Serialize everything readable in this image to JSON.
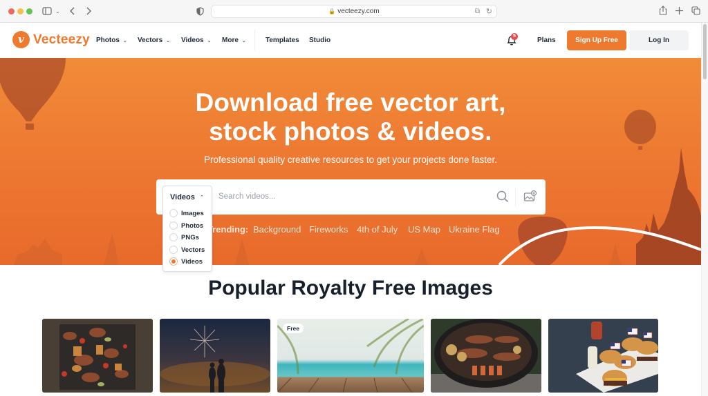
{
  "browser": {
    "url": "vecteezy.com",
    "icons": [
      "sidebar-icon",
      "chevron-down-icon",
      "back-icon",
      "forward-icon",
      "shield-icon",
      "lock-icon",
      "translate-icon",
      "reload-icon",
      "share-icon",
      "new-tab-icon",
      "tabs-overview-icon"
    ]
  },
  "nav": {
    "brand": "Vecteezy",
    "logo_glyph": "v",
    "menu": [
      {
        "label": "Photos",
        "has_dropdown": true
      },
      {
        "label": "Vectors",
        "has_dropdown": true
      },
      {
        "label": "Videos",
        "has_dropdown": true
      },
      {
        "label": "More",
        "has_dropdown": true
      },
      {
        "label": "Templates",
        "has_dropdown": false
      },
      {
        "label": "Studio",
        "has_dropdown": false
      }
    ],
    "notification_count": "5",
    "plans": "Plans",
    "signup": "Sign Up Free",
    "login": "Log In",
    "chev": "⌄"
  },
  "hero": {
    "title_line1": "Download free vector art,",
    "title_line2": "stock photos & videos.",
    "subtitle": "Professional quality creative resources to get your projects done faster.",
    "search": {
      "type_selected": "Videos",
      "placeholder": "Search videos...",
      "value": ""
    },
    "dropdown": {
      "options": [
        {
          "label": "Images",
          "selected": false
        },
        {
          "label": "Photos",
          "selected": false
        },
        {
          "label": "PNGs",
          "selected": false
        },
        {
          "label": "Vectors",
          "selected": false
        },
        {
          "label": "Videos",
          "selected": true
        }
      ]
    },
    "trending_label": "Trending:",
    "trending": [
      "Background",
      "Fireworks",
      "4th of July",
      "US Map",
      "Ukraine Flag"
    ]
  },
  "popular": {
    "title": "Popular Royalty Free Images",
    "images": [
      {
        "subject": "grilled meat and vegetables on campfire grill",
        "badge": ""
      },
      {
        "subject": "couple watching fireworks over city at night",
        "badge": ""
      },
      {
        "subject": "wooden deck with blurred tropical beach and palm leaves",
        "badge": "Free"
      },
      {
        "subject": "barbecue skewers on round charcoal grill",
        "badge": ""
      },
      {
        "subject": "burgers with american flags on serving board",
        "badge": ""
      }
    ]
  },
  "colors": {
    "brand_orange": "#ee7a30",
    "notification_red": "#e5484d",
    "heading_dark": "#17202b"
  }
}
